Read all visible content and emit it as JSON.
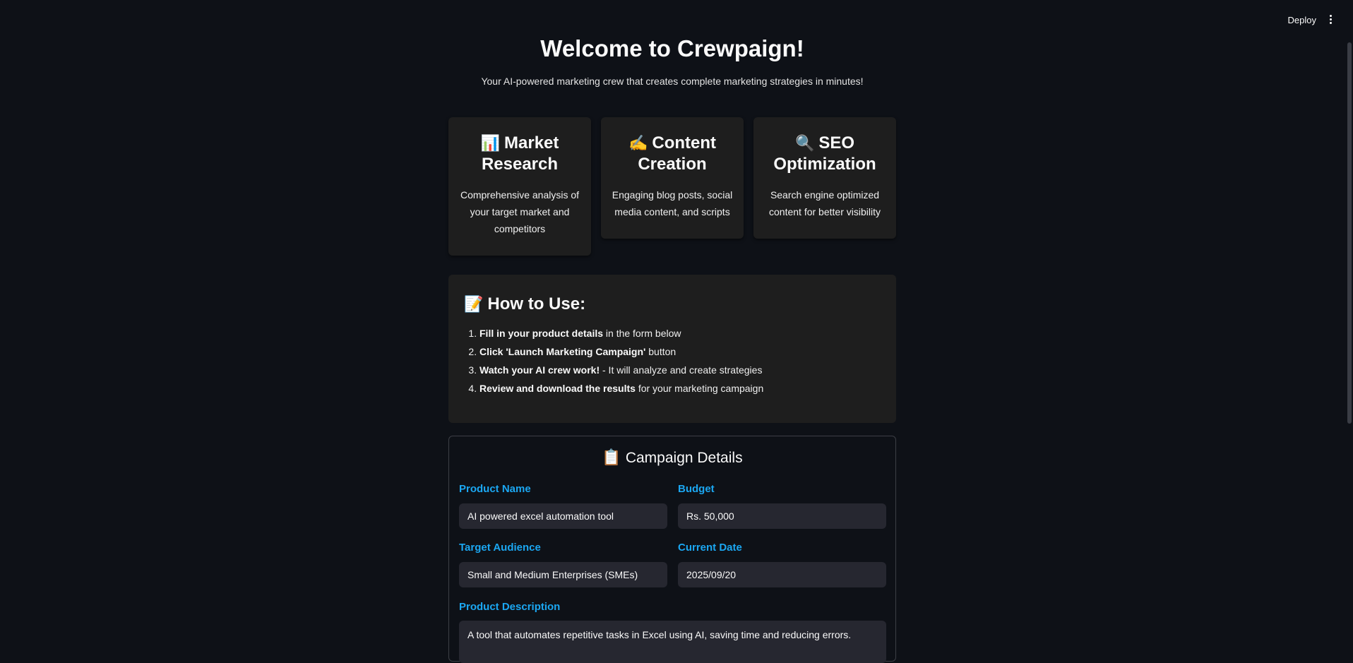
{
  "header": {
    "deploy_label": "Deploy",
    "menu_icon": "vertical-dots-icon"
  },
  "hero": {
    "title": "Welcome to Crewpaign!",
    "subtitle": "Your AI-powered marketing crew that creates complete marketing strategies in minutes!"
  },
  "features": [
    {
      "emoji": "📊",
      "icon": "bar-chart-icon",
      "title": "Market Research",
      "description": "Comprehensive analysis of your target market and competitors"
    },
    {
      "emoji": "✍️",
      "icon": "writing-hand-icon",
      "title": "Content Creation",
      "description": "Engaging blog posts, social media content, and scripts"
    },
    {
      "emoji": "🔍",
      "icon": "magnifier-icon",
      "title": "SEO Optimization",
      "description": "Search engine optimized content for better visibility"
    }
  ],
  "how_to": {
    "emoji": "📝",
    "icon": "memo-icon",
    "title": "How to Use:",
    "steps": [
      {
        "bold": "Fill in your product details",
        "rest": " in the form below"
      },
      {
        "bold": "Click 'Launch Marketing Campaign'",
        "rest": " button"
      },
      {
        "bold": "Watch your AI crew work!",
        "rest": " - It will analyze and create strategies"
      },
      {
        "bold": "Review and download the results",
        "rest": " for your marketing campaign"
      }
    ]
  },
  "form": {
    "emoji": "📋",
    "icon": "clipboard-icon",
    "title": "Campaign Details",
    "product_name": {
      "label": "Product Name",
      "value": "AI powered excel automation tool"
    },
    "budget": {
      "label": "Budget",
      "value": "Rs. 50,000"
    },
    "target_audience": {
      "label": "Target Audience",
      "value": "Small and Medium Enterprises (SMEs)"
    },
    "current_date": {
      "label": "Current Date",
      "value": "2025/09/20"
    },
    "product_description": {
      "label": "Product Description",
      "value": "A tool that automates repetitive tasks in Excel using AI, saving time and reducing errors."
    }
  },
  "colors": {
    "background": "#0e1117",
    "card": "#1e1e1e",
    "label_accent": "#1ba7f2",
    "input_bg": "#262730"
  }
}
